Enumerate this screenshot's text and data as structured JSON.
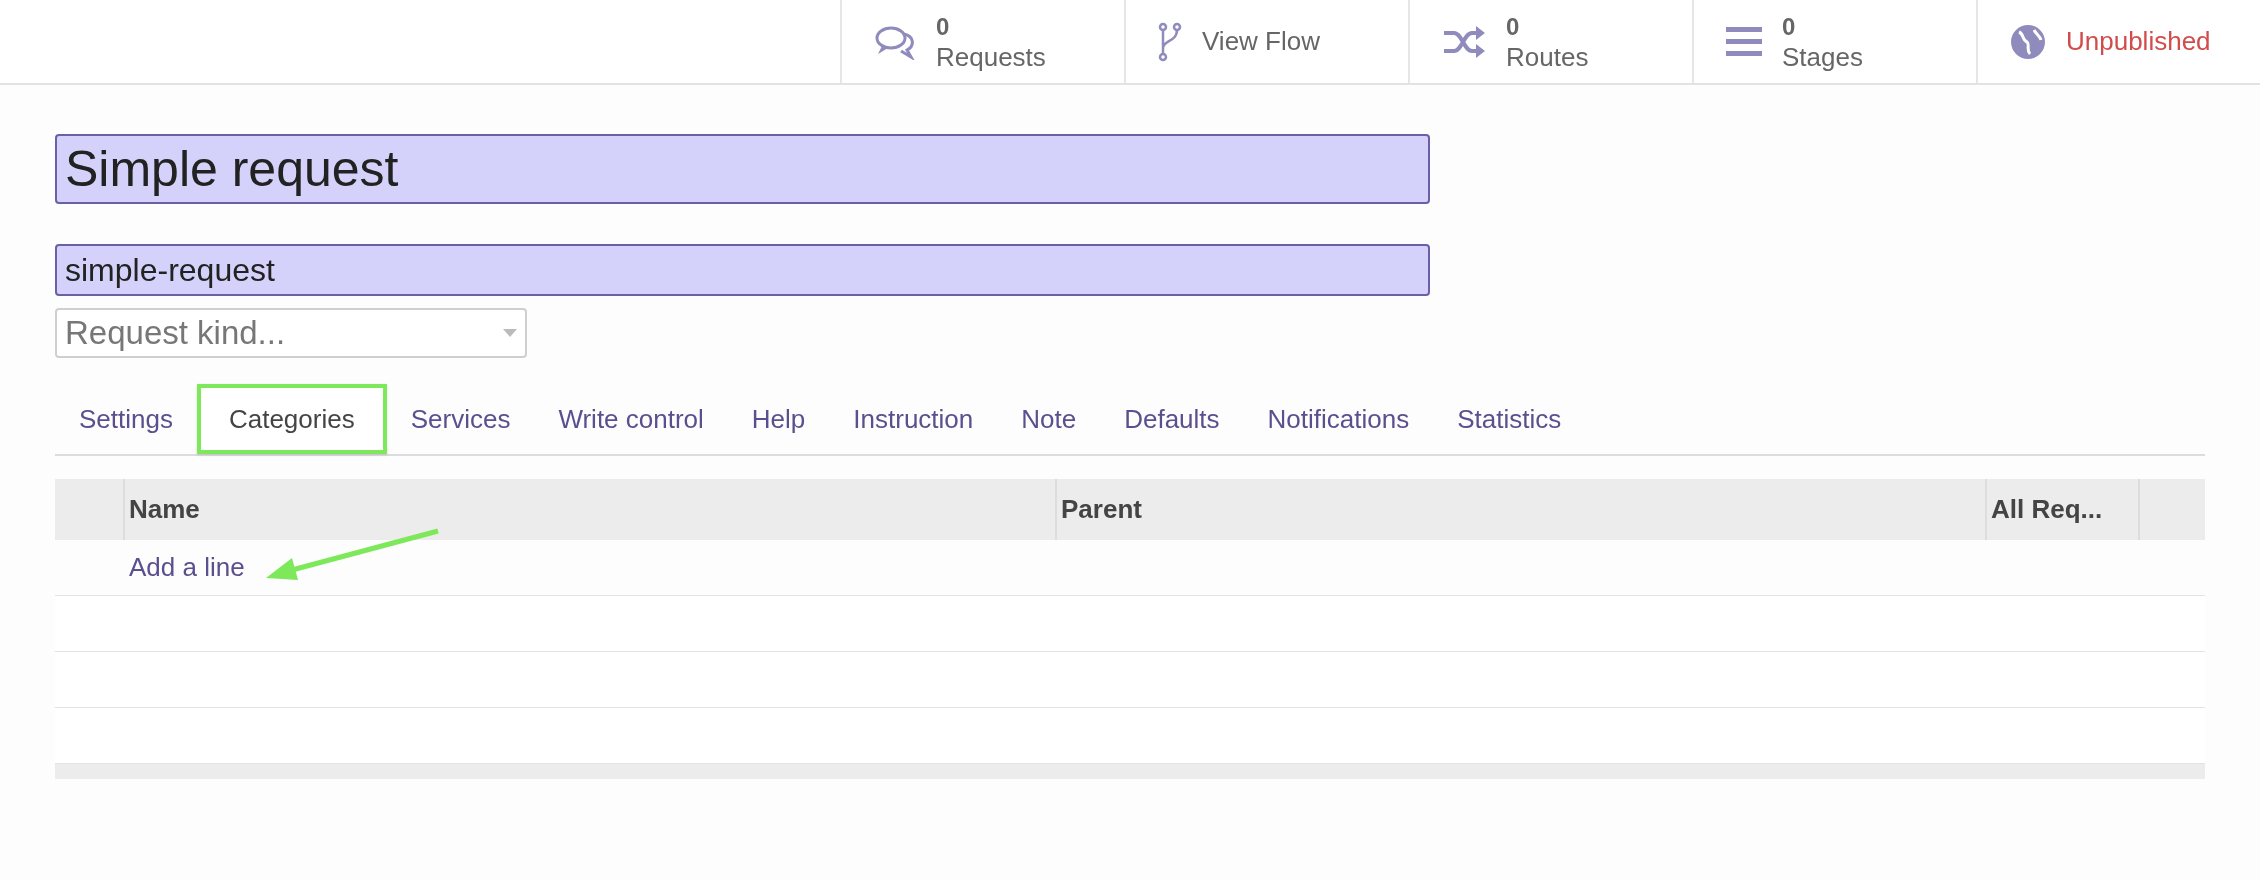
{
  "top_bar": {
    "buttons": [
      {
        "kind": "counter",
        "count": "0",
        "label": "Requests"
      },
      {
        "kind": "plain",
        "label": "View Flow"
      },
      {
        "kind": "counter",
        "count": "0",
        "label": "Routes"
      },
      {
        "kind": "counter",
        "count": "0",
        "label": "Stages"
      },
      {
        "kind": "status",
        "label": "Unpublished"
      }
    ]
  },
  "form": {
    "title": {
      "value": "Simple request"
    },
    "slug": {
      "value": "simple-request"
    },
    "kind_select": {
      "placeholder": "Request kind..."
    }
  },
  "tabs": [
    {
      "label": "Settings",
      "selected": false
    },
    {
      "label": "Categories",
      "selected": true
    },
    {
      "label": "Services",
      "selected": false
    },
    {
      "label": "Write control",
      "selected": false
    },
    {
      "label": "Help",
      "selected": false
    },
    {
      "label": "Instruction",
      "selected": false
    },
    {
      "label": "Note",
      "selected": false
    },
    {
      "label": "Defaults",
      "selected": false
    },
    {
      "label": "Notifications",
      "selected": false
    },
    {
      "label": "Statistics",
      "selected": false
    }
  ],
  "table": {
    "columns": [
      "Name",
      "Parent",
      "All Req..."
    ],
    "add_line": "Add a line"
  }
}
